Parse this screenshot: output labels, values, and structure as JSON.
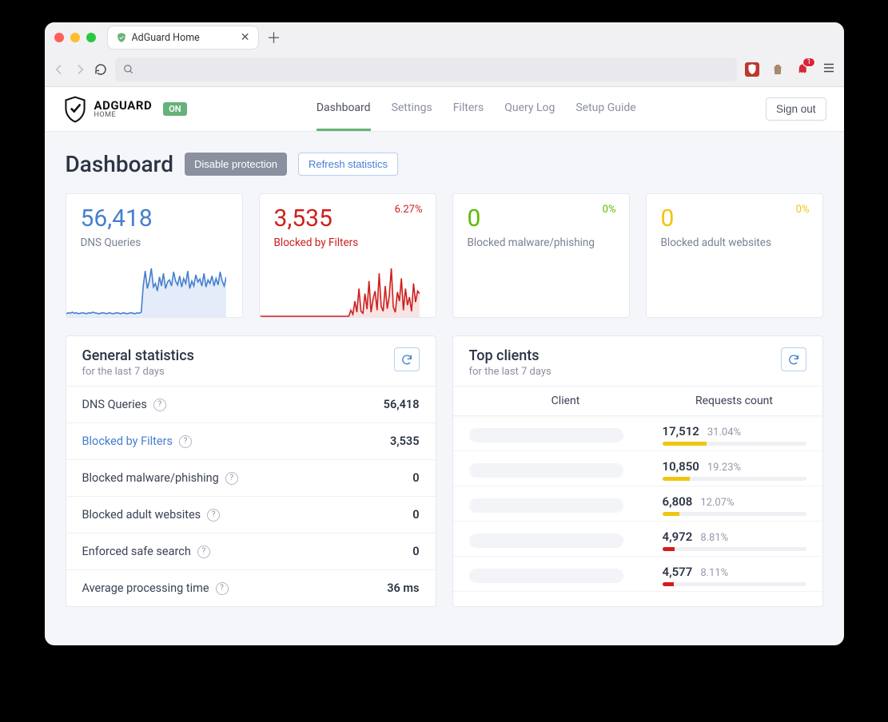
{
  "browser": {
    "tab_title": "AdGuard Home",
    "badge_count": "1"
  },
  "header": {
    "brand_line1": "ADGUARD",
    "brand_line2": "HOME",
    "status": "ON",
    "nav": {
      "dashboard": "Dashboard",
      "settings": "Settings",
      "filters": "Filters",
      "querylog": "Query Log",
      "setup": "Setup Guide"
    },
    "sign_out": "Sign out"
  },
  "page": {
    "title": "Dashboard",
    "disable_btn": "Disable protection",
    "refresh_btn": "Refresh statistics"
  },
  "cards": {
    "dns": {
      "value": "56,418",
      "label": "DNS Queries"
    },
    "blocked": {
      "value": "3,535",
      "label": "Blocked by Filters",
      "pct": "6.27%"
    },
    "malware": {
      "value": "0",
      "label": "Blocked malware/phishing",
      "pct": "0%"
    },
    "adult": {
      "value": "0",
      "label": "Blocked adult websites",
      "pct": "0%"
    }
  },
  "general": {
    "title": "General statistics",
    "subtitle": "for the last 7 days",
    "rows": [
      {
        "label": "DNS Queries",
        "value": "56,418",
        "blue": false
      },
      {
        "label": "Blocked by Filters",
        "value": "3,535",
        "blue": true
      },
      {
        "label": "Blocked malware/phishing",
        "value": "0",
        "blue": false
      },
      {
        "label": "Blocked adult websites",
        "value": "0",
        "blue": false
      },
      {
        "label": "Enforced safe search",
        "value": "0",
        "blue": false
      },
      {
        "label": "Average processing time",
        "value": "36 ms",
        "blue": false
      }
    ]
  },
  "clients": {
    "title": "Top clients",
    "subtitle": "for the last 7 days",
    "col_client": "Client",
    "col_requests": "Requests count",
    "rows": [
      {
        "count": "17,512",
        "pct": "31.04%",
        "width": 31.04,
        "color": "yellow"
      },
      {
        "count": "10,850",
        "pct": "19.23%",
        "width": 19.23,
        "color": "yellow"
      },
      {
        "count": "6,808",
        "pct": "12.07%",
        "width": 12.07,
        "color": "yellow"
      },
      {
        "count": "4,972",
        "pct": "8.81%",
        "width": 8.81,
        "color": "red"
      },
      {
        "count": "4,577",
        "pct": "8.11%",
        "width": 8.11,
        "color": "red"
      }
    ]
  },
  "chart_data": [
    {
      "type": "line",
      "name": "DNS Queries sparkline",
      "x_range": [
        0,
        100
      ],
      "y_range": [
        0,
        100
      ],
      "values": [
        5,
        7,
        6,
        8,
        6,
        7,
        5,
        6,
        7,
        6,
        5,
        7,
        6,
        8,
        7,
        6,
        5,
        6,
        7,
        6,
        5,
        7,
        6,
        5,
        6,
        7,
        6,
        5,
        7,
        6,
        5,
        6,
        7,
        6,
        5,
        7,
        6,
        8,
        60,
        90,
        55,
        70,
        95,
        58,
        65,
        50,
        78,
        60,
        85,
        55,
        68,
        72,
        60,
        88,
        70,
        62,
        80,
        58,
        75,
        65,
        90,
        55,
        70,
        60,
        82,
        68,
        74,
        60,
        85,
        58,
        72,
        65,
        80,
        60,
        75,
        62,
        88,
        70,
        60,
        78
      ]
    },
    {
      "type": "line",
      "name": "Blocked by Filters sparkline",
      "x_range": [
        0,
        100
      ],
      "y_range": [
        0,
        100
      ],
      "values": [
        0,
        0,
        0,
        0,
        0,
        0,
        0,
        0,
        0,
        0,
        0,
        0,
        0,
        0,
        0,
        0,
        0,
        0,
        0,
        0,
        0,
        0,
        0,
        0,
        0,
        0,
        0,
        0,
        0,
        0,
        0,
        0,
        0,
        0,
        0,
        0,
        0,
        0,
        0,
        0,
        0,
        0,
        0,
        0,
        0,
        12,
        4,
        30,
        8,
        55,
        10,
        6,
        45,
        14,
        70,
        8,
        35,
        50,
        12,
        85,
        20,
        10,
        60,
        15,
        40,
        95,
        18,
        8,
        48,
        30,
        75,
        12,
        55,
        22,
        38,
        10,
        65,
        28,
        50,
        45
      ]
    }
  ]
}
